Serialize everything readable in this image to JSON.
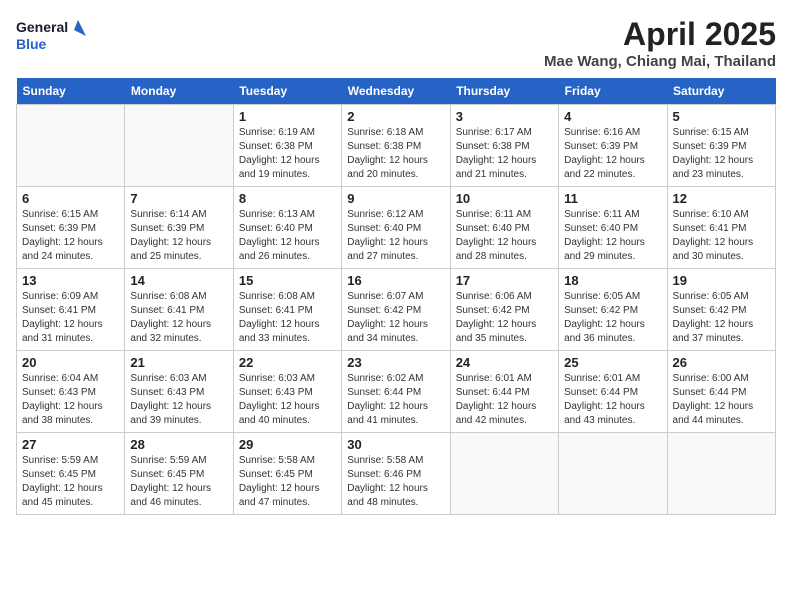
{
  "logo": {
    "line1": "General",
    "line2": "Blue"
  },
  "title": "April 2025",
  "location": "Mae Wang, Chiang Mai, Thailand",
  "days_of_week": [
    "Sunday",
    "Monday",
    "Tuesday",
    "Wednesday",
    "Thursday",
    "Friday",
    "Saturday"
  ],
  "weeks": [
    [
      {
        "day": "",
        "sunrise": "",
        "sunset": "",
        "daylight": ""
      },
      {
        "day": "",
        "sunrise": "",
        "sunset": "",
        "daylight": ""
      },
      {
        "day": "1",
        "sunrise": "Sunrise: 6:19 AM",
        "sunset": "Sunset: 6:38 PM",
        "daylight": "Daylight: 12 hours and 19 minutes."
      },
      {
        "day": "2",
        "sunrise": "Sunrise: 6:18 AM",
        "sunset": "Sunset: 6:38 PM",
        "daylight": "Daylight: 12 hours and 20 minutes."
      },
      {
        "day": "3",
        "sunrise": "Sunrise: 6:17 AM",
        "sunset": "Sunset: 6:38 PM",
        "daylight": "Daylight: 12 hours and 21 minutes."
      },
      {
        "day": "4",
        "sunrise": "Sunrise: 6:16 AM",
        "sunset": "Sunset: 6:39 PM",
        "daylight": "Daylight: 12 hours and 22 minutes."
      },
      {
        "day": "5",
        "sunrise": "Sunrise: 6:15 AM",
        "sunset": "Sunset: 6:39 PM",
        "daylight": "Daylight: 12 hours and 23 minutes."
      }
    ],
    [
      {
        "day": "6",
        "sunrise": "Sunrise: 6:15 AM",
        "sunset": "Sunset: 6:39 PM",
        "daylight": "Daylight: 12 hours and 24 minutes."
      },
      {
        "day": "7",
        "sunrise": "Sunrise: 6:14 AM",
        "sunset": "Sunset: 6:39 PM",
        "daylight": "Daylight: 12 hours and 25 minutes."
      },
      {
        "day": "8",
        "sunrise": "Sunrise: 6:13 AM",
        "sunset": "Sunset: 6:40 PM",
        "daylight": "Daylight: 12 hours and 26 minutes."
      },
      {
        "day": "9",
        "sunrise": "Sunrise: 6:12 AM",
        "sunset": "Sunset: 6:40 PM",
        "daylight": "Daylight: 12 hours and 27 minutes."
      },
      {
        "day": "10",
        "sunrise": "Sunrise: 6:11 AM",
        "sunset": "Sunset: 6:40 PM",
        "daylight": "Daylight: 12 hours and 28 minutes."
      },
      {
        "day": "11",
        "sunrise": "Sunrise: 6:11 AM",
        "sunset": "Sunset: 6:40 PM",
        "daylight": "Daylight: 12 hours and 29 minutes."
      },
      {
        "day": "12",
        "sunrise": "Sunrise: 6:10 AM",
        "sunset": "Sunset: 6:41 PM",
        "daylight": "Daylight: 12 hours and 30 minutes."
      }
    ],
    [
      {
        "day": "13",
        "sunrise": "Sunrise: 6:09 AM",
        "sunset": "Sunset: 6:41 PM",
        "daylight": "Daylight: 12 hours and 31 minutes."
      },
      {
        "day": "14",
        "sunrise": "Sunrise: 6:08 AM",
        "sunset": "Sunset: 6:41 PM",
        "daylight": "Daylight: 12 hours and 32 minutes."
      },
      {
        "day": "15",
        "sunrise": "Sunrise: 6:08 AM",
        "sunset": "Sunset: 6:41 PM",
        "daylight": "Daylight: 12 hours and 33 minutes."
      },
      {
        "day": "16",
        "sunrise": "Sunrise: 6:07 AM",
        "sunset": "Sunset: 6:42 PM",
        "daylight": "Daylight: 12 hours and 34 minutes."
      },
      {
        "day": "17",
        "sunrise": "Sunrise: 6:06 AM",
        "sunset": "Sunset: 6:42 PM",
        "daylight": "Daylight: 12 hours and 35 minutes."
      },
      {
        "day": "18",
        "sunrise": "Sunrise: 6:05 AM",
        "sunset": "Sunset: 6:42 PM",
        "daylight": "Daylight: 12 hours and 36 minutes."
      },
      {
        "day": "19",
        "sunrise": "Sunrise: 6:05 AM",
        "sunset": "Sunset: 6:42 PM",
        "daylight": "Daylight: 12 hours and 37 minutes."
      }
    ],
    [
      {
        "day": "20",
        "sunrise": "Sunrise: 6:04 AM",
        "sunset": "Sunset: 6:43 PM",
        "daylight": "Daylight: 12 hours and 38 minutes."
      },
      {
        "day": "21",
        "sunrise": "Sunrise: 6:03 AM",
        "sunset": "Sunset: 6:43 PM",
        "daylight": "Daylight: 12 hours and 39 minutes."
      },
      {
        "day": "22",
        "sunrise": "Sunrise: 6:03 AM",
        "sunset": "Sunset: 6:43 PM",
        "daylight": "Daylight: 12 hours and 40 minutes."
      },
      {
        "day": "23",
        "sunrise": "Sunrise: 6:02 AM",
        "sunset": "Sunset: 6:44 PM",
        "daylight": "Daylight: 12 hours and 41 minutes."
      },
      {
        "day": "24",
        "sunrise": "Sunrise: 6:01 AM",
        "sunset": "Sunset: 6:44 PM",
        "daylight": "Daylight: 12 hours and 42 minutes."
      },
      {
        "day": "25",
        "sunrise": "Sunrise: 6:01 AM",
        "sunset": "Sunset: 6:44 PM",
        "daylight": "Daylight: 12 hours and 43 minutes."
      },
      {
        "day": "26",
        "sunrise": "Sunrise: 6:00 AM",
        "sunset": "Sunset: 6:44 PM",
        "daylight": "Daylight: 12 hours and 44 minutes."
      }
    ],
    [
      {
        "day": "27",
        "sunrise": "Sunrise: 5:59 AM",
        "sunset": "Sunset: 6:45 PM",
        "daylight": "Daylight: 12 hours and 45 minutes."
      },
      {
        "day": "28",
        "sunrise": "Sunrise: 5:59 AM",
        "sunset": "Sunset: 6:45 PM",
        "daylight": "Daylight: 12 hours and 46 minutes."
      },
      {
        "day": "29",
        "sunrise": "Sunrise: 5:58 AM",
        "sunset": "Sunset: 6:45 PM",
        "daylight": "Daylight: 12 hours and 47 minutes."
      },
      {
        "day": "30",
        "sunrise": "Sunrise: 5:58 AM",
        "sunset": "Sunset: 6:46 PM",
        "daylight": "Daylight: 12 hours and 48 minutes."
      },
      {
        "day": "",
        "sunrise": "",
        "sunset": "",
        "daylight": ""
      },
      {
        "day": "",
        "sunrise": "",
        "sunset": "",
        "daylight": ""
      },
      {
        "day": "",
        "sunrise": "",
        "sunset": "",
        "daylight": ""
      }
    ]
  ]
}
